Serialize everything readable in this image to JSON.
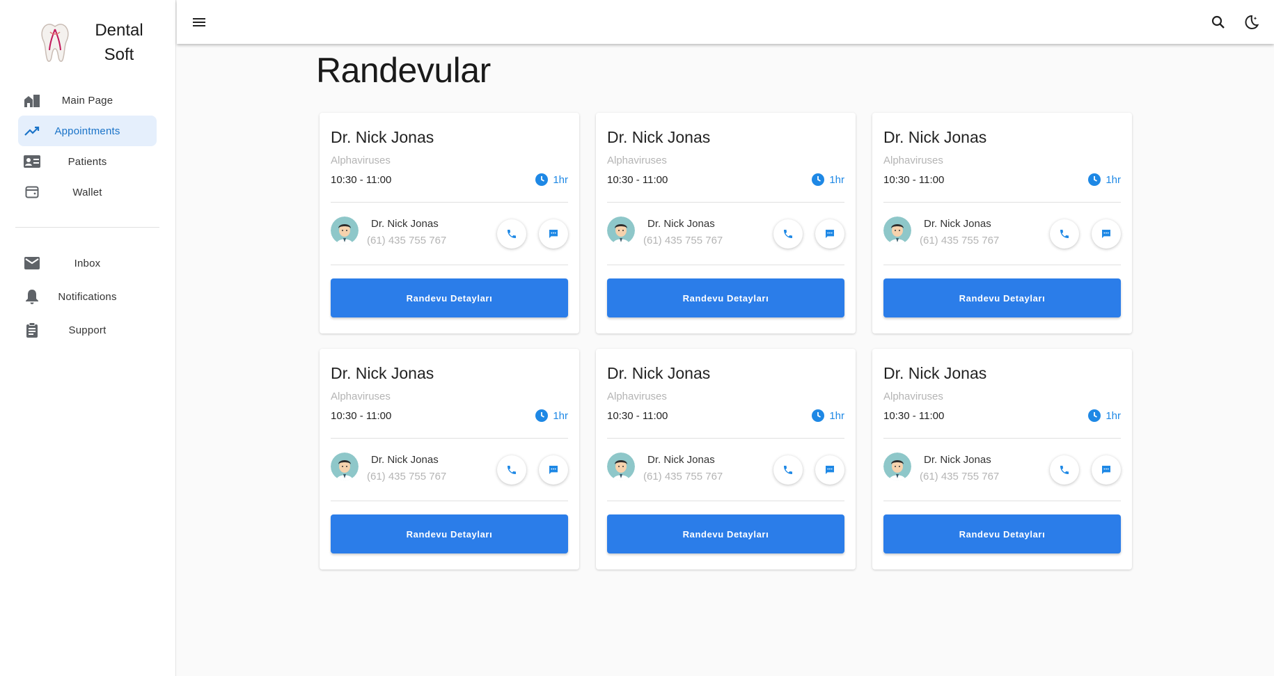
{
  "brand": {
    "line1": "Dental",
    "line2": "Soft",
    "logo_icon": "tooth-logo-icon"
  },
  "sidebar": {
    "primary": [
      {
        "label": "Main Page",
        "icon": "building-icon",
        "active": false
      },
      {
        "label": "Appointments",
        "icon": "trending-up-icon",
        "active": true
      },
      {
        "label": "Patients",
        "icon": "contact-card-icon",
        "active": false
      },
      {
        "label": "Wallet",
        "icon": "wallet-icon",
        "active": false
      }
    ],
    "secondary": [
      {
        "label": "Inbox",
        "icon": "mail-icon"
      },
      {
        "label": "Notifications",
        "icon": "bell-icon"
      },
      {
        "label": "Support",
        "icon": "clipboard-icon"
      }
    ]
  },
  "topbar": {
    "menu_icon": "menu-icon",
    "search_icon": "search-icon",
    "theme_icon": "moon-icon"
  },
  "page": {
    "title": "Randevular"
  },
  "colors": {
    "accent": "#2b7de9",
    "active_bg": "#e5effc",
    "duration": "#1e88e5"
  },
  "cards": [
    {
      "doctor": "Dr. Nick Jonas",
      "specialty": "Alphaviruses",
      "time": "10:30 - 11:00",
      "duration": "1hr",
      "contact_name": "Dr. Nick Jonas",
      "contact_phone": "(61) 435 755 767",
      "button": "Randevu Detayları"
    },
    {
      "doctor": "Dr. Nick Jonas",
      "specialty": "Alphaviruses",
      "time": "10:30 - 11:00",
      "duration": "1hr",
      "contact_name": "Dr. Nick Jonas",
      "contact_phone": "(61) 435 755 767",
      "button": "Randevu Detayları"
    },
    {
      "doctor": "Dr. Nick Jonas",
      "specialty": "Alphaviruses",
      "time": "10:30 - 11:00",
      "duration": "1hr",
      "contact_name": "Dr. Nick Jonas",
      "contact_phone": "(61) 435 755 767",
      "button": "Randevu Detayları"
    },
    {
      "doctor": "Dr. Nick Jonas",
      "specialty": "Alphaviruses",
      "time": "10:30 - 11:00",
      "duration": "1hr",
      "contact_name": "Dr. Nick Jonas",
      "contact_phone": "(61) 435 755 767",
      "button": "Randevu Detayları"
    },
    {
      "doctor": "Dr. Nick Jonas",
      "specialty": "Alphaviruses",
      "time": "10:30 - 11:00",
      "duration": "1hr",
      "contact_name": "Dr. Nick Jonas",
      "contact_phone": "(61) 435 755 767",
      "button": "Randevu Detayları"
    },
    {
      "doctor": "Dr. Nick Jonas",
      "specialty": "Alphaviruses",
      "time": "10:30 - 11:00",
      "duration": "1hr",
      "contact_name": "Dr. Nick Jonas",
      "contact_phone": "(61) 435 755 767",
      "button": "Randevu Detayları"
    }
  ]
}
